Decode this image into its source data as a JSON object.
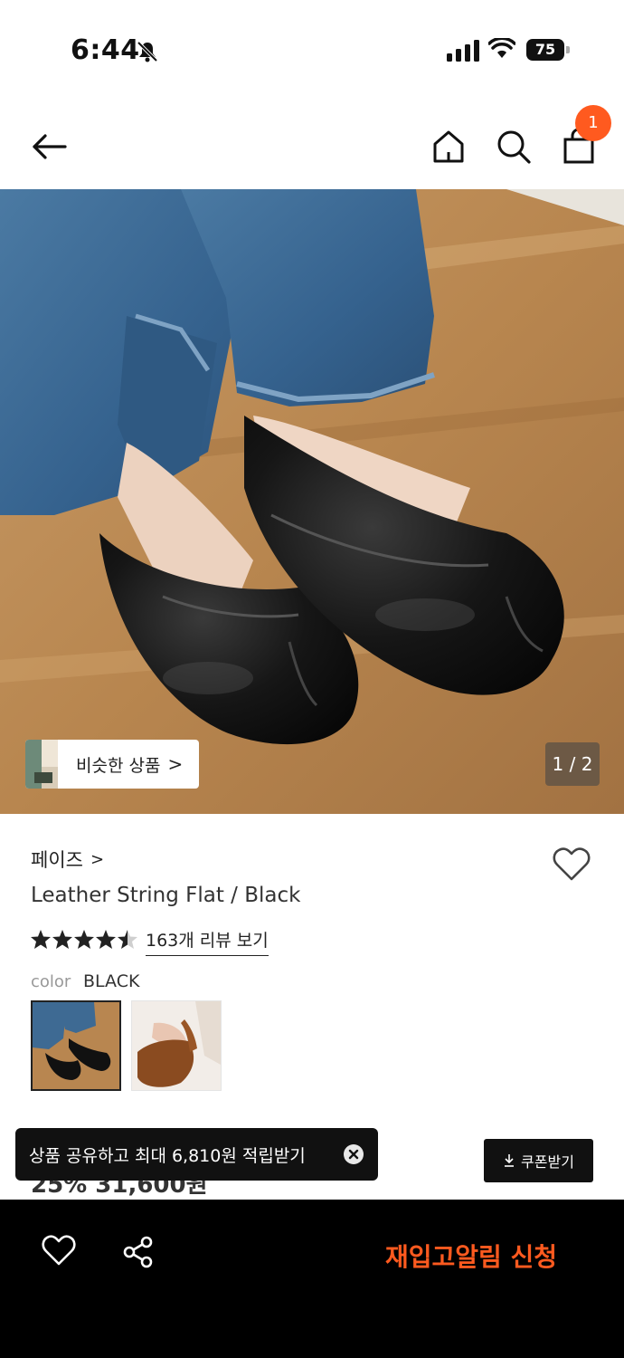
{
  "status_bar": {
    "time": "6:44",
    "battery": "75"
  },
  "header": {
    "cart_count": "1"
  },
  "image": {
    "similar_label": "비슷한 상품",
    "similar_chevron": ">",
    "page_indicator": "1 / 2"
  },
  "product": {
    "brand": "페이즈",
    "brand_chevron": ">",
    "title": "Leather String Flat / Black",
    "rating": 4.5,
    "review_link": "163개 리뷰 보기",
    "color_label": "color",
    "color_value": "BLACK",
    "price_peek": "25% 31,600원"
  },
  "toast": {
    "text": "상품 공유하고 최대 6,810원 적립받기"
  },
  "coupon": {
    "label": "쿠폰받기"
  },
  "bottom_bar": {
    "restock_label": "재입고알림 신청"
  },
  "colors": {
    "accent": "#ff5a1f",
    "dark": "#111111"
  }
}
